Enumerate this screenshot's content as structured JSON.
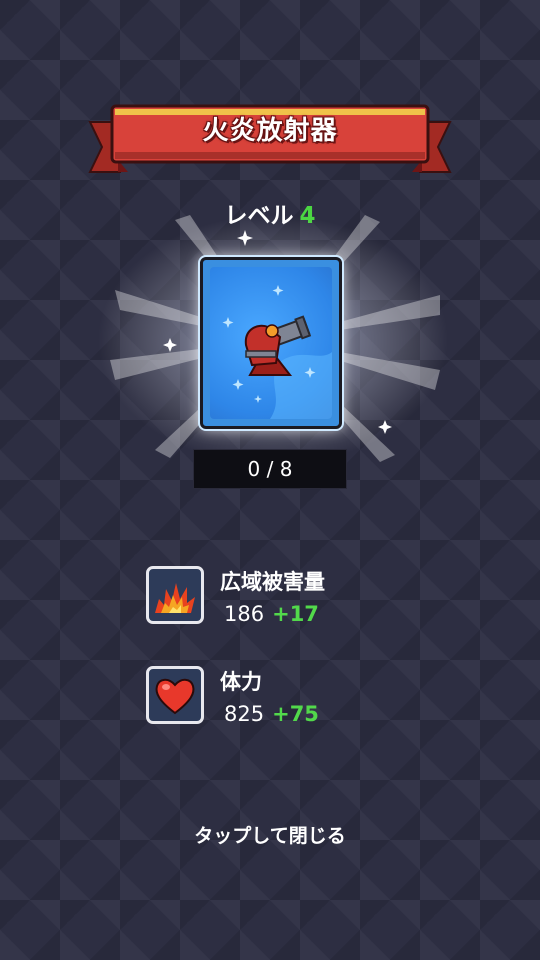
{
  "title": "火炎放射器",
  "level": {
    "label": "レベル",
    "value": "4"
  },
  "card": {
    "icon": "flamethrower-turret-icon"
  },
  "progress": {
    "text": "0 / 8",
    "current": 0,
    "max": 8
  },
  "stats": [
    {
      "name": "広域被害量",
      "value": "186",
      "bonus": "+17",
      "icon": "explosion-icon"
    },
    {
      "name": "体力",
      "value": "825",
      "bonus": "+75",
      "icon": "heart-icon"
    }
  ],
  "footer": "タップして閉じる",
  "colors": {
    "ribbon": "#d8423a",
    "bonus": "#52d94b",
    "card": "#3a8fe0",
    "background": "#2d2e42"
  }
}
